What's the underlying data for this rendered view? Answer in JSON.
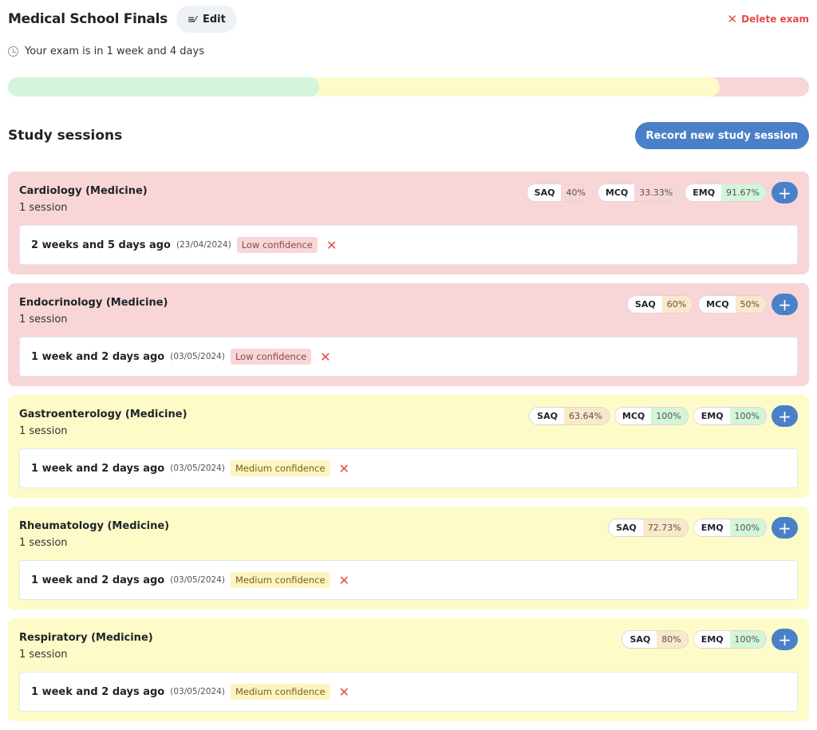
{
  "header": {
    "title": "Medical School Finals",
    "edit_label": "Edit",
    "edit_icon": "edit-list-icon",
    "delete_label": "Delete exam",
    "delete_icon": "close-icon",
    "countdown_text": "Your exam is in 1 week and 4 days",
    "countdown_icon": "clock-icon"
  },
  "progress": {
    "segments": [
      {
        "status": "good",
        "color": "#d3f5da",
        "percent": 38.8
      },
      {
        "status": "medium",
        "color": "#fdfbc8",
        "percent": 50.0
      },
      {
        "status": "low",
        "color": "#f8d6d7",
        "percent": 11.2
      }
    ]
  },
  "study": {
    "section_title": "Study sessions",
    "record_label": "Record new study session",
    "topics": [
      {
        "title": "Cardiology (Medicine)",
        "count": "1 session",
        "color": "red",
        "scores": [
          {
            "label": "SAQ",
            "value": "40%",
            "tone": "red"
          },
          {
            "label": "MCQ",
            "value": "33.33%",
            "tone": "red"
          },
          {
            "label": "EMQ",
            "value": "91.67%",
            "tone": "green"
          }
        ],
        "sessions": [
          {
            "ago": "2 weeks and 5 days ago",
            "date": "(23/04/2024)",
            "confidence": "Low confidence",
            "level": "low"
          }
        ]
      },
      {
        "title": "Endocrinology (Medicine)",
        "count": "1 session",
        "color": "red",
        "scores": [
          {
            "label": "SAQ",
            "value": "60%",
            "tone": "orange"
          },
          {
            "label": "MCQ",
            "value": "50%",
            "tone": "orange"
          }
        ],
        "sessions": [
          {
            "ago": "1 week and 2 days ago",
            "date": "(03/05/2024)",
            "confidence": "Low confidence",
            "level": "low"
          }
        ]
      },
      {
        "title": "Gastroenterology (Medicine)",
        "count": "1 session",
        "color": "yellow",
        "scores": [
          {
            "label": "SAQ",
            "value": "63.64%",
            "tone": "orange"
          },
          {
            "label": "MCQ",
            "value": "100%",
            "tone": "green"
          },
          {
            "label": "EMQ",
            "value": "100%",
            "tone": "green"
          }
        ],
        "sessions": [
          {
            "ago": "1 week and 2 days ago",
            "date": "(03/05/2024)",
            "confidence": "Medium confidence",
            "level": "medium"
          }
        ]
      },
      {
        "title": "Rheumatology (Medicine)",
        "count": "1 session",
        "color": "yellow",
        "scores": [
          {
            "label": "SAQ",
            "value": "72.73%",
            "tone": "orange"
          },
          {
            "label": "EMQ",
            "value": "100%",
            "tone": "green"
          }
        ],
        "sessions": [
          {
            "ago": "1 week and 2 days ago",
            "date": "(03/05/2024)",
            "confidence": "Medium confidence",
            "level": "medium"
          }
        ]
      },
      {
        "title": "Respiratory (Medicine)",
        "count": "1 session",
        "color": "yellow",
        "scores": [
          {
            "label": "SAQ",
            "value": "80%",
            "tone": "orange"
          },
          {
            "label": "EMQ",
            "value": "100%",
            "tone": "green"
          }
        ],
        "sessions": [
          {
            "ago": "1 week and 2 days ago",
            "date": "(03/05/2024)",
            "confidence": "Medium confidence",
            "level": "medium"
          }
        ]
      }
    ]
  },
  "icons": {
    "add": "plus-icon",
    "remove": "close-icon"
  }
}
